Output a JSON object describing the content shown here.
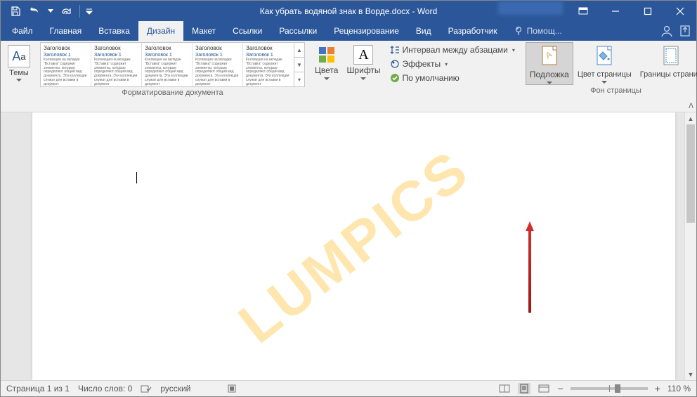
{
  "title": "Как убрать водяной знак в Ворде.docx - Word",
  "qat": {
    "save": "save",
    "undo": "undo",
    "redo": "redo",
    "customize": "customize"
  },
  "tabs": {
    "file": "Файл",
    "home": "Главная",
    "insert": "Вставка",
    "design": "Дизайн",
    "layout": "Макет",
    "references": "Ссылки",
    "mailings": "Рассылки",
    "review": "Рецензирование",
    "view": "Вид",
    "developer": "Разработчик",
    "tell": "Помощ..."
  },
  "ribbon": {
    "themes": "Темы",
    "gallery_heading": "Заголовок",
    "gallery_sub": "Заголовок 1",
    "gallery_body": "Коллекция на вкладке \"Вставка\" содержит элементы, которые определяют общий вид документа. Эти коллекции служат для вставки в документ",
    "doc_formatting_label": "Форматирование документа",
    "colors": "Цвета",
    "fonts": "Шрифты",
    "para_spacing": "Интервал между абзацами",
    "effects": "Эффекты",
    "default": "По умолчанию",
    "watermark": "Подложка",
    "page_color": "Цвет страницы",
    "page_borders": "Границы страниц",
    "page_bg_label": "Фон страницы"
  },
  "document": {
    "watermark_text": "LUMPICS"
  },
  "status": {
    "page": "Страница 1 из 1",
    "words": "Число слов: 0",
    "lang": "русский",
    "zoom": "110 %"
  },
  "zoom": {
    "minus": "−",
    "plus": "+"
  }
}
